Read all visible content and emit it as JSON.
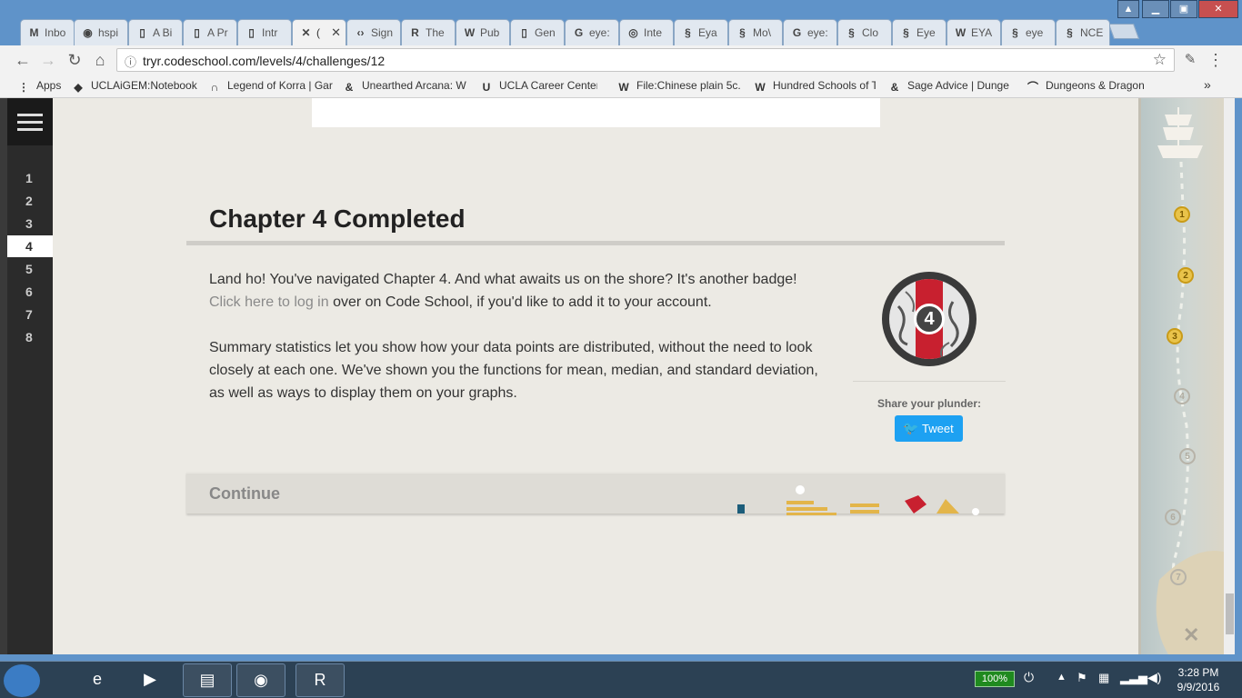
{
  "browser": {
    "tabs": [
      {
        "label": "Inbo",
        "icon": "M"
      },
      {
        "label": "hspi",
        "icon": "◉"
      },
      {
        "label": "A Bi",
        "icon": "▯"
      },
      {
        "label": "A Pr",
        "icon": "▯"
      },
      {
        "label": "Intr",
        "icon": "▯"
      },
      {
        "label": "(",
        "icon": "✕",
        "active": true
      },
      {
        "label": "Sign",
        "icon": "‹›"
      },
      {
        "label": "The",
        "icon": "R"
      },
      {
        "label": "Pub",
        "icon": "W"
      },
      {
        "label": "Gen",
        "icon": "▯"
      },
      {
        "label": "eye:",
        "icon": "G"
      },
      {
        "label": "Inte",
        "icon": "◎"
      },
      {
        "label": "Eya",
        "icon": "§"
      },
      {
        "label": "Mo\\",
        "icon": "§"
      },
      {
        "label": "eye:",
        "icon": "G"
      },
      {
        "label": "Clo",
        "icon": "§"
      },
      {
        "label": "Eye",
        "icon": "§"
      },
      {
        "label": "EYA",
        "icon": "W"
      },
      {
        "label": "eye",
        "icon": "§"
      },
      {
        "label": "NCE",
        "icon": "§"
      }
    ],
    "url": "tryr.codeschool.com/levels/4/challenges/12",
    "bookmarks": [
      {
        "label": "Apps",
        "icon": "⋮"
      },
      {
        "label": "UCLAiGEM:Notebook",
        "icon": "◆"
      },
      {
        "label": "Legend of Korra | Gar",
        "icon": "∩"
      },
      {
        "label": "Unearthed Arcana: W",
        "icon": "&"
      },
      {
        "label": "UCLA Career Center",
        "icon": "U"
      },
      {
        "label": "File:Chinese plain 5c.",
        "icon": "W"
      },
      {
        "label": "Hundred Schools of T",
        "icon": "W"
      },
      {
        "label": "Sage Advice | Dunge",
        "icon": "&"
      },
      {
        "label": "Dungeons & Dragons",
        "icon": "⌒"
      }
    ]
  },
  "sidebar": {
    "levels": [
      "1",
      "2",
      "3",
      "4",
      "5",
      "6",
      "7",
      "8"
    ],
    "current_level": "4"
  },
  "main": {
    "heading": "Chapter 4 Completed",
    "para1_before": "Land ho! You've navigated Chapter 4. And what awaits us on the shore? It's another badge! ",
    "para1_link": "Click here to log in",
    "para1_after": " over on Code School, if you'd like to add it to your account.",
    "para2": "Summary statistics let you show how your data points are distributed, without the need to look closely at each one. We've shown you the functions for mean, median, and standard deviation, as well as ways to display them on your graphs.",
    "badge_number": "4",
    "share_label": "Share your plunder:",
    "tweet_label": "Tweet",
    "continue_label": "Continue"
  },
  "map": {
    "nodes": [
      {
        "label": "1",
        "done": true
      },
      {
        "label": "2",
        "done": true
      },
      {
        "label": "3",
        "done": true
      },
      {
        "label": "4",
        "done": false
      },
      {
        "label": "5",
        "done": false
      },
      {
        "label": "6",
        "done": false
      },
      {
        "label": "7",
        "done": false
      }
    ],
    "end_marker": "✕"
  },
  "taskbar": {
    "battery": "100%",
    "time": "3:28 PM",
    "date": "9/9/2016"
  },
  "colors": {
    "accent_red": "#c8202f",
    "tweet_blue": "#1da1f2",
    "gold": "#e9c34a"
  }
}
